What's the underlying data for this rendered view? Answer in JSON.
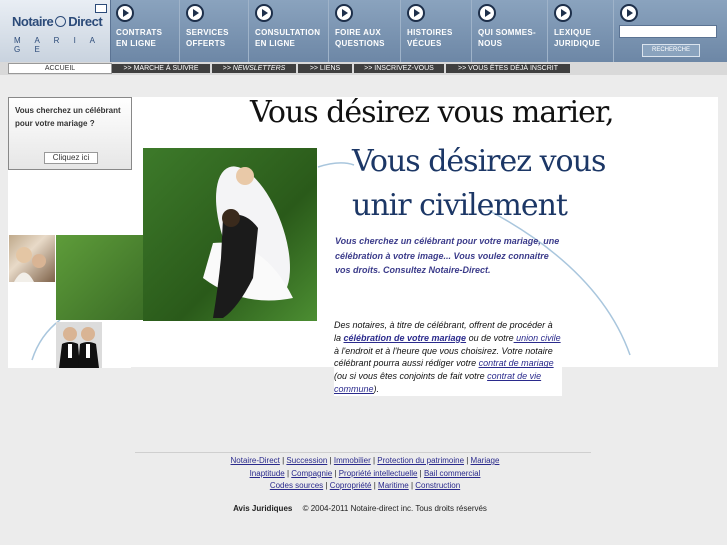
{
  "logo": {
    "name": "Notaire",
    "name2": "Direct",
    "sub": "M A R I A G E"
  },
  "nav": [
    {
      "label": "CONTRATS\nEN LIGNE"
    },
    {
      "label": "SERVICES\nOFFERTS"
    },
    {
      "label": "CONSULTATION\nEN LIGNE"
    },
    {
      "label": "FOIRE AUX\nQUESTIONS"
    },
    {
      "label": "HISTOIRES\nVÉCUES"
    },
    {
      "label": "QUI SOMMES-\nNOUS"
    },
    {
      "label": "LEXIQUE\nJURIDIQUE"
    }
  ],
  "search": {
    "value": "",
    "button": "RECHERCHE"
  },
  "subnav": [
    {
      "label": "ACCUEIL"
    },
    {
      "label": ">> MARCHE À SUIVRE"
    },
    {
      "label": ">> NEWSLETTERS"
    },
    {
      "label": ">> LIENS"
    },
    {
      "label": ">> INSCRIVEZ-VOUS"
    },
    {
      "label": ">> VOUS ÊTES DÉJÀ INSCRIT"
    }
  ],
  "promo": {
    "text": "Vous cherchez un célébrant pour votre mariage ?",
    "button": "Cliquez ici"
  },
  "headline1": "Vous désirez vous marier,",
  "headline2": "Vous désirez vous unir civilement",
  "intro": "Vous cherchez un célébrant pour votre mariage, une célébration à votre image... Vous voulez connaitre vos droits. Consultez Notaire-Direct.",
  "para": {
    "t1": "Des notaires, à titre de célébrant, offrent de procéder à la ",
    "link1": "célébration de votre mariage",
    "t2": " ou de votre",
    "link2": " union civile",
    "t3": " à l'endroit et à l'heure que vous choisirez. Votre notaire célébrant pourra aussi rédiger votre ",
    "link3": "contrat de mariage",
    "t4": " (ou si vous êtes conjoints de fait votre ",
    "link4": "contrat de vie commune",
    "t5": ")."
  },
  "footer": {
    "links": [
      "Notaire-Direct",
      "Succession",
      "Immobilier",
      "Protection du patrimoine",
      "Mariage",
      "Inaptitude",
      "Compagnie",
      "Propriété intellectuelle",
      "Bail commercial",
      "Codes sources",
      "Copropriété",
      "Maritime",
      "Construction"
    ],
    "legal": "Avis Juridiques",
    "copyright": "© 2004-2011 Notaire-direct inc. Tous droits réservés"
  },
  "colors": {
    "nav_bg": "#7a93b1",
    "headline_blue": "#1c3766",
    "intro_blue": "#3b3b8a",
    "link": "#2a2a8c"
  }
}
